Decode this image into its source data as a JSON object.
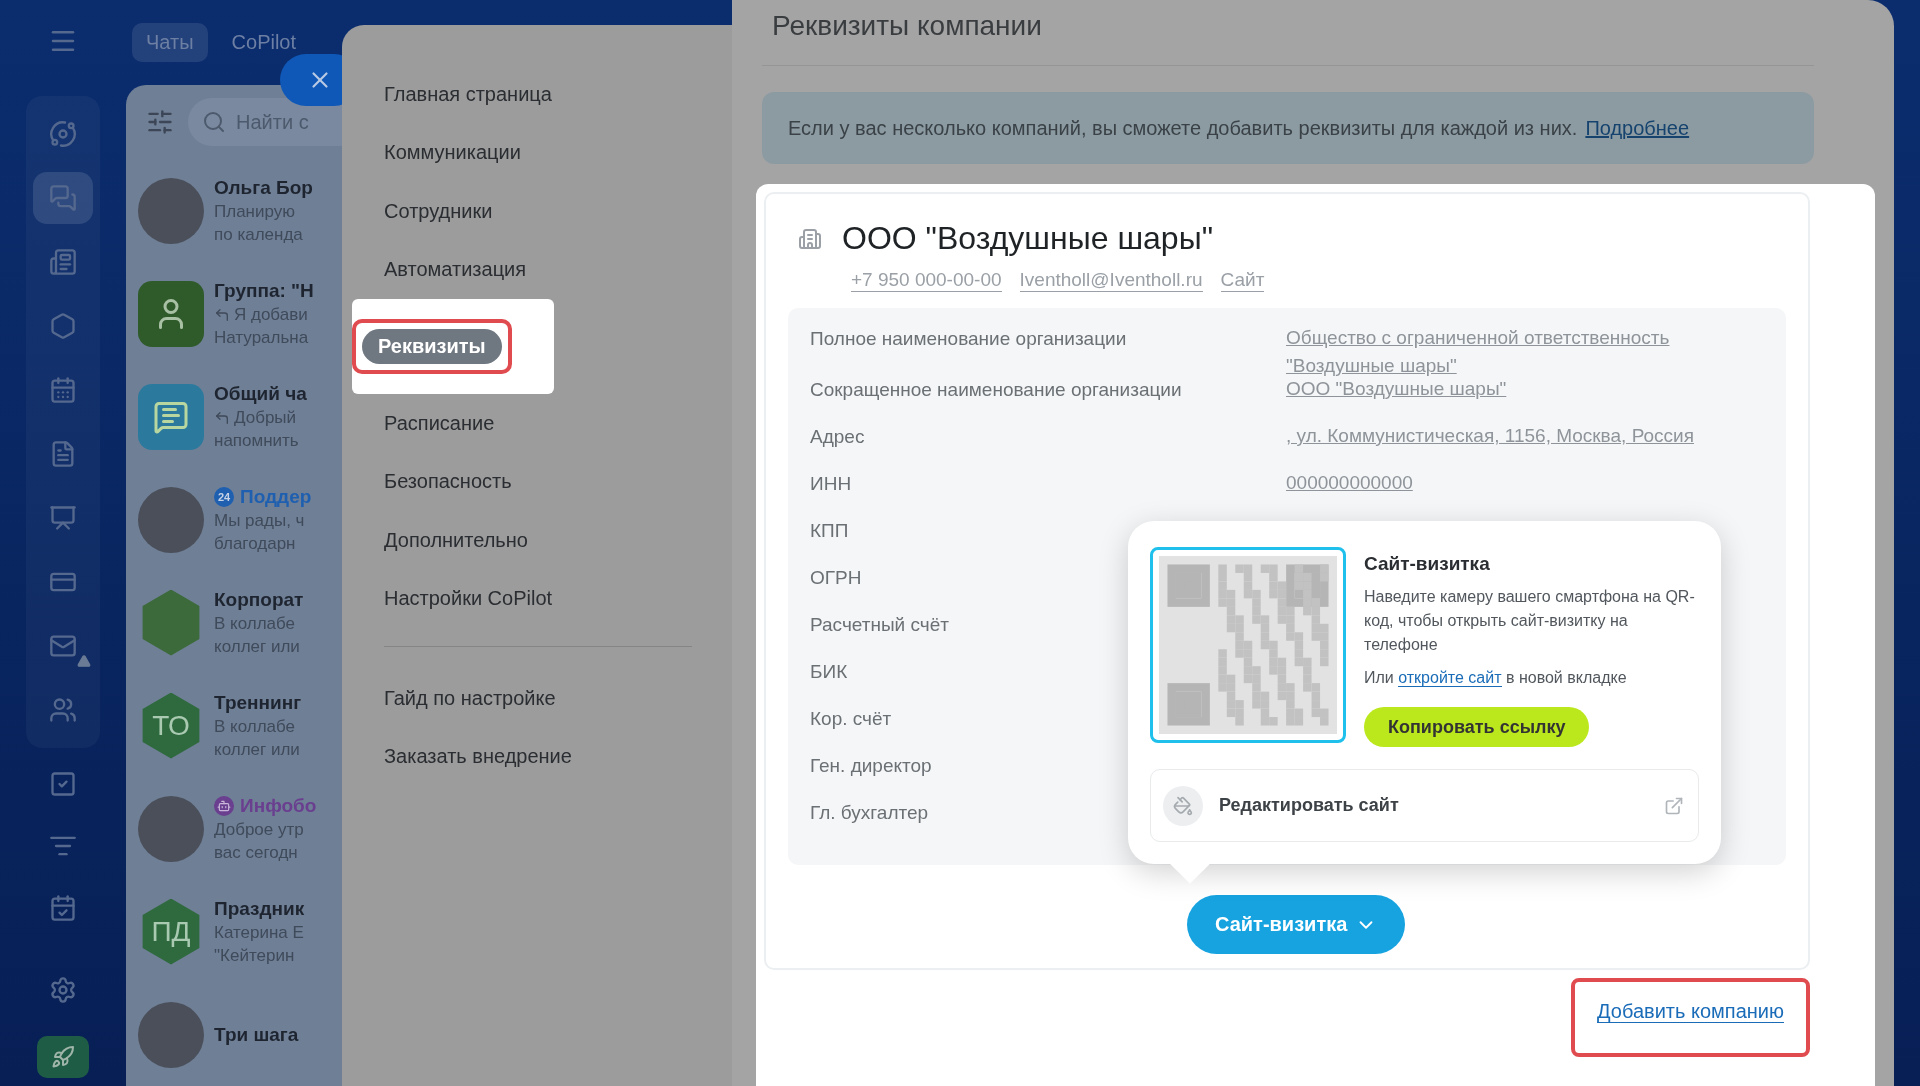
{
  "nav": [
    {
      "selected": false,
      "warning": false
    },
    {
      "selected": true,
      "warning": false
    },
    {
      "selected": false,
      "warning": false
    },
    {
      "selected": false,
      "warning": false
    },
    {
      "selected": false,
      "warning": false
    },
    {
      "selected": false,
      "warning": false
    },
    {
      "selected": false,
      "warning": false
    },
    {
      "selected": false,
      "warning": false
    },
    {
      "selected": false,
      "warning": true
    },
    {
      "selected": false,
      "warning": false
    },
    {
      "selected": false,
      "warning": false
    },
    {
      "selected": false,
      "warning": false
    },
    {
      "selected": false,
      "warning": false
    }
  ],
  "top_tabs": [
    {
      "label": "Чаты",
      "selected": true
    },
    {
      "label": "CoPilot",
      "selected": false
    }
  ],
  "chat_search": {
    "placeholder": "Найти с"
  },
  "chats": [
    {
      "name": "Ольга Бор",
      "preview": [
        "Планирую",
        "по календа"
      ],
      "kind": "photo",
      "reply": false
    },
    {
      "name": "Группа: \"Н",
      "preview": [
        "Я добави",
        "Натуральна"
      ],
      "kind": "group",
      "reply": true
    },
    {
      "name": "Общий ча",
      "preview": [
        "Добрый",
        "напомнить"
      ],
      "kind": "chat",
      "reply": true
    },
    {
      "name": "Поддер",
      "preview": [
        "Мы рады, ч",
        "благодарн"
      ],
      "kind": "photo",
      "reply": false,
      "color": "#1f5fb0",
      "badge": {
        "kind": "number",
        "text": "24"
      }
    },
    {
      "name": "Корпорат",
      "preview": [
        "В коллабе",
        "коллег или"
      ],
      "kind": "hex-photo",
      "reply": false
    },
    {
      "name": "Треннинг",
      "preview": [
        "В коллабе",
        "коллег или"
      ],
      "kind": "hex-initials",
      "initials": "ТО",
      "reply": false
    },
    {
      "name": "Инфобо",
      "preview": [
        "Доброе утр",
        "вас сегодн"
      ],
      "kind": "photo",
      "reply": false,
      "color": "#6a3f8f",
      "badge": {
        "kind": "bot"
      }
    },
    {
      "name": "Праздник",
      "preview": [
        "Катерина Е",
        "\"Кейтерин"
      ],
      "kind": "hex-initials",
      "initials": "ПД",
      "reply": false
    },
    {
      "name": "Три шага",
      "kind": "photo"
    }
  ],
  "settings_menu": {
    "items": [
      {
        "label": "Главная страница",
        "selected": false
      },
      {
        "label": "Коммуникации",
        "selected": false
      },
      {
        "label": "Сотрудники",
        "selected": false
      },
      {
        "label": "Автоматизация",
        "selected": false
      },
      {
        "label": "Реквизиты",
        "selected": true
      },
      {
        "label": "Расписание",
        "selected": false
      },
      {
        "label": "Безопасность",
        "selected": false
      },
      {
        "label": "Дополнительно",
        "selected": false
      },
      {
        "label": "Настройки CoPilot",
        "selected": false
      }
    ],
    "extra_links": [
      "Гайд по настройке",
      "Заказать внедрение"
    ]
  },
  "page": {
    "title": "Реквизиты компании",
    "banner": {
      "text": "Если у вас несколько компаний, вы сможете добавить реквизиты для каждой из них.",
      "link": "Подробнее"
    },
    "company": {
      "name": "ООО \"Воздушные шары\"",
      "contacts": [
        "+7 950 000-00-00",
        "Iventholl@Iventholl.ru",
        "Сайт"
      ],
      "details": [
        {
          "label": "Полное наименование организации",
          "value": "Общество с ограниченной ответственность \"Воздушные шары\""
        },
        {
          "label": "Сокращенное наименование организации",
          "value": "ООО \"Воздушные шары\""
        },
        {
          "label": "Адрес",
          "value": ", ул. Коммунистическая, 1156, Москва, Россия"
        },
        {
          "label": "ИНН",
          "value": "000000000000"
        },
        {
          "label": "КПП"
        },
        {
          "label": "ОГРН"
        },
        {
          "label": "Расчетный счёт"
        },
        {
          "label": "БИК"
        },
        {
          "label": "Кор. счёт"
        },
        {
          "label": "Ген. директор"
        },
        {
          "label": "Гл. бухгалтер"
        }
      ],
      "site_button": "Сайт-визитка",
      "popover": {
        "title": "Сайт-визитка",
        "text": "Наведите камеру вашего смартфона на QR-код, чтобы открыть сайт-визитку на телефоне",
        "open_prefix": "Или",
        "open_link": "откройте сайт",
        "open_suffix": "в новой вкладке",
        "copy_button": "Копировать ссылку",
        "edit_label": "Редактировать сайт"
      }
    },
    "add_company": "Добавить компанию"
  }
}
